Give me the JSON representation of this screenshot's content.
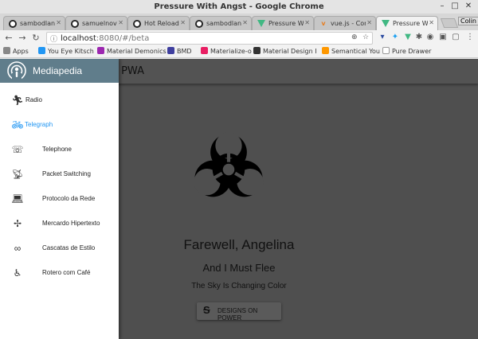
{
  "window": {
    "title": "Pressure With Angst - Google Chrome"
  },
  "tabs": [
    {
      "label": "sambodlan",
      "icon": "github-icon",
      "active": false
    },
    {
      "label": "samuelnova",
      "icon": "github-icon",
      "active": false
    },
    {
      "label": "Hot Reloadi",
      "icon": "github-icon",
      "active": false
    },
    {
      "label": "sambodlan",
      "icon": "github-icon",
      "active": false
    },
    {
      "label": "Pressure Wi",
      "icon": "vue-icon",
      "active": false
    },
    {
      "label": "vue.js - Con",
      "icon": "vue-icon",
      "active": false
    },
    {
      "label": "Pressure Wi",
      "icon": "vue-icon",
      "active": true
    }
  ],
  "profile_label": "Colin",
  "address": {
    "host": "localhost",
    "path": ":8080/#/beta"
  },
  "bookmarks": [
    {
      "label": "Apps",
      "color": "#888888"
    },
    {
      "label": "You Eye Kitsch",
      "color": "#2196f3"
    },
    {
      "label": "Material Demonics",
      "color": "#9c27b0"
    },
    {
      "label": "BMD",
      "color": "#3f3f9f"
    },
    {
      "label": "Materialize-o",
      "color": "#e91e63"
    },
    {
      "label": "Material Design I",
      "color": "#333333"
    },
    {
      "label": "Semantical You",
      "color": "#ff9800"
    },
    {
      "label": "Pure Drawer",
      "color": "#999999"
    }
  ],
  "appbar": {
    "title": "o PWA"
  },
  "drawer": {
    "title": "Mediapedia",
    "header_color": "#607d8b",
    "items": [
      {
        "label": "Radio",
        "icon": "running-icon",
        "active": false
      },
      {
        "label": "Telegraph",
        "icon": "bicycle-icon",
        "active": true
      },
      {
        "label": "Telephone",
        "icon": "phone-ringing-icon",
        "active": false
      },
      {
        "label": "Packet Switching",
        "icon": "satellite-dish-icon",
        "active": false
      },
      {
        "label": "Protocolo da Rede",
        "icon": "laptop-icon",
        "active": false
      },
      {
        "label": "Mercardo Hipertexto",
        "icon": "fan-icon",
        "active": false
      },
      {
        "label": "Cascatas de Estilo",
        "icon": "infinity-icon",
        "active": false
      },
      {
        "label": "Rotero com Café",
        "icon": "wheelchair-icon",
        "active": false
      }
    ]
  },
  "main": {
    "hero_icon": "biohazard-icon",
    "heading": "Farewell, Angelina",
    "subheading": "And I Must Flee",
    "caption": "The Sky Is Changing Color",
    "button_label": "DESIGNS ON POWER"
  }
}
